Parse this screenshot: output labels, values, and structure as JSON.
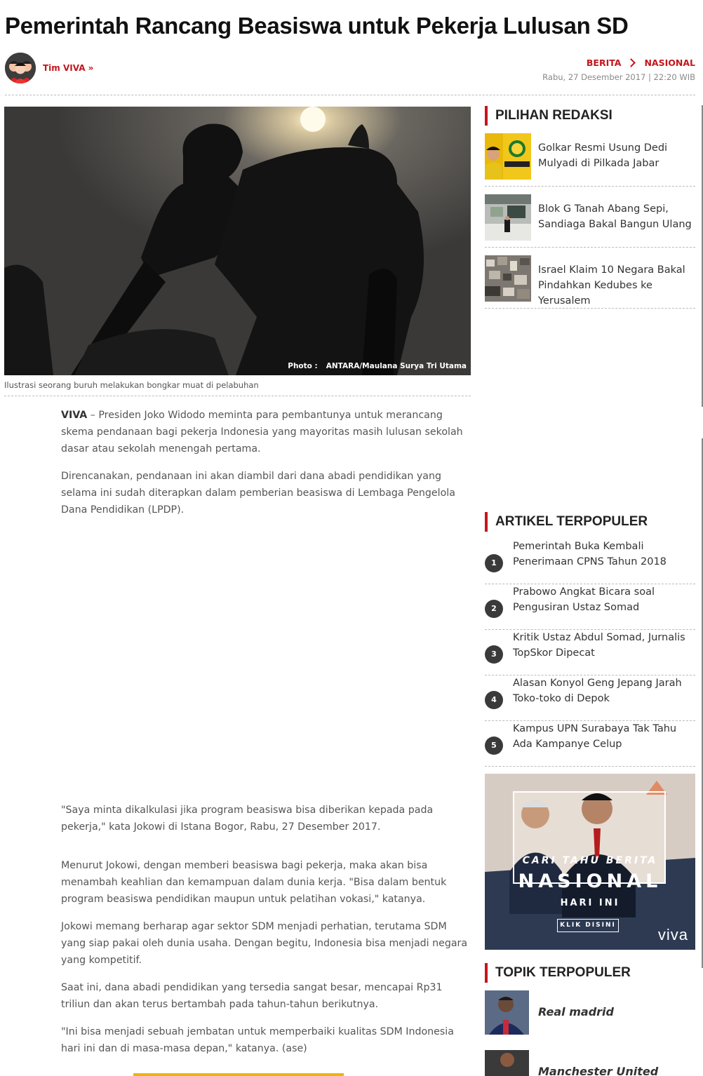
{
  "article": {
    "title": "Pemerintah Rancang Beasiswa untuk Pekerja Lulusan SD",
    "author": "Tim VIVA »",
    "breadcrumb": [
      "BERITA",
      "NASIONAL"
    ],
    "date": "Rabu, 27 Desember 2017 | 22:20 WIB",
    "photo_credit_label": "Photo :",
    "photo_credit": "ANTARA/Maulana Surya Tri Utama",
    "caption": "Ilustrasi seorang buruh melakukan bongkar muat di pelabuhan",
    "lead_source": "VIVA",
    "paragraphs": [
      " – Presiden Joko Widodo meminta para pembantunya untuk merancang skema pendanaan bagi pekerja Indonesia yang mayoritas masih lulusan sekolah dasar atau sekolah menengah pertama.",
      "Direncanakan, pendanaan ini akan diambil dari dana abadi pendidikan yang selama ini sudah diterapkan dalam pemberian beasiswa di Lembaga Pengelola Dana Pendidikan (LPDP).",
      "\"Saya minta dikalkulasi jika program beasiswa bisa diberikan kepada pada pekerja,\" kata Jokowi di Istana Bogor, Rabu, 27 Desember 2017.",
      "Menurut Jokowi, dengan memberi beasiswa bagi pekerja, maka akan bisa menambah keahlian dan kemampuan dalam dunia kerja. \"Bisa dalam bentuk program beasiswa pendidikan maupun untuk pelatihan vokasi,\" katanya.",
      "Jokowi memang berharap agar sektor SDM menjadi perhatian, terutama SDM yang siap pakai oleh dunia usaha. Dengan begitu, Indonesia bisa menjadi negara yang kompetitif.",
      "Saat ini, dana abadi pendidikan yang tersedia sangat besar, mencapai Rp31 triliun dan akan terus bertambah pada tahun-tahun berikutnya.",
      "\"Ini bisa menjadi sebuah jembatan untuk memperbaiki kualitas SDM Indonesia hari ini dan di masa-masa depan,\" katanya. (ase)"
    ]
  },
  "sidebar": {
    "pilihan_title": "PILIHAN REDAKSI",
    "pilihan": [
      {
        "title": "Golkar Resmi Usung Dedi Mulyadi di Pilkada Jabar"
      },
      {
        "title": "Blok G Tanah Abang Sepi, Sandiaga Bakal Bangun Ulang"
      },
      {
        "title": "Israel Klaim 10 Negara Bakal Pindahkan Kedubes ke Yerusalem"
      }
    ],
    "popular_title": "ARTIKEL TERPOPULER",
    "popular": [
      {
        "num": "1",
        "title": "Pemerintah Buka Kembali Penerimaan CPNS Tahun 2018"
      },
      {
        "num": "2",
        "title": "Prabowo Angkat Bicara soal Pengusiran Ustaz Somad"
      },
      {
        "num": "3",
        "title": "Kritik Ustaz Abdul Somad, Jurnalis TopSkor Dipecat"
      },
      {
        "num": "4",
        "title": "Alasan Konyol Geng Jepang Jarah Toko-toko di Depok"
      },
      {
        "num": "5",
        "title": "Kampus UPN Surabaya Tak Tahu Ada Kampanye Celup"
      }
    ],
    "banner": {
      "line1": "CARI TAHU BERITA",
      "line2": "NASIONAL",
      "line3": "HARI INI",
      "button": "KLIK DISINI",
      "logo": "viva"
    },
    "topik_title": "TOPIK TERPOPULER",
    "topik": [
      {
        "title": "Real madrid"
      },
      {
        "title": "Manchester United"
      }
    ]
  },
  "colors": {
    "accent": "#c4161c",
    "text": "#333333",
    "muted": "#555555"
  }
}
